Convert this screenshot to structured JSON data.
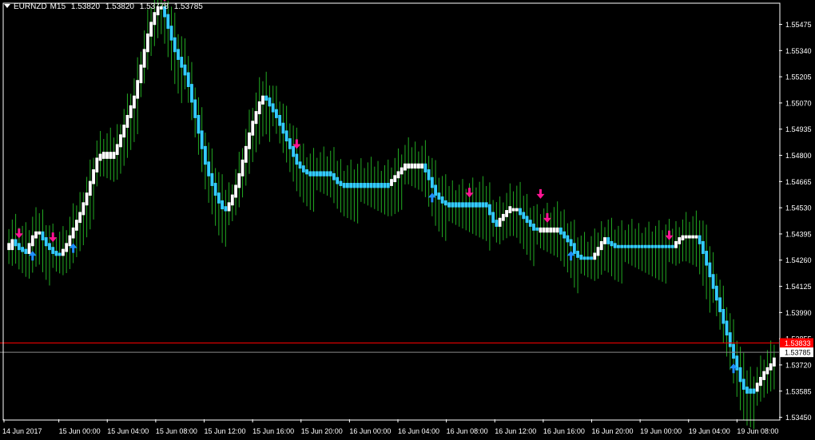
{
  "window": {
    "symbol": "EURNZD",
    "timeframe": "M15",
    "open": "1.53820",
    "high": "1.53820",
    "low": "1.53778",
    "close": "1.53785"
  },
  "price_axis": {
    "labels": [
      "1.55475",
      "1.55340",
      "1.55205",
      "1.55070",
      "1.54935",
      "1.54800",
      "1.54665",
      "1.54530",
      "1.54395",
      "1.54260",
      "1.54125",
      "1.53990",
      "1.53855",
      "1.53720",
      "1.53585",
      "1.53450"
    ]
  },
  "time_axis": {
    "labels": [
      "14 Jun 2017",
      "15 Jun 00:00",
      "15 Jun 04:00",
      "15 Jun 08:00",
      "15 Jun 12:00",
      "15 Jun 16:00",
      "15 Jun 20:00",
      "16 Jun 00:00",
      "16 Jun 04:00",
      "16 Jun 08:00",
      "16 Jun 12:00",
      "16 Jun 16:00",
      "16 Jun 20:00",
      "19 Jun 00:00",
      "19 Jun 04:00",
      "19 Jun 08:00"
    ]
  },
  "current_price": {
    "label": "1.53785",
    "value": 1.53785,
    "color": "#ffffff"
  },
  "ask_line": {
    "label": "1.53833",
    "value": 1.53833,
    "color": "#ff0000"
  },
  "colors": {
    "background": "#000000",
    "axis": "#ffffff",
    "bull_candle": "#ffffff",
    "bear_candle": "#33ccff",
    "wick": "#22aa22",
    "arrow_up": "#1e90ff",
    "arrow_down": "#ff1493"
  },
  "chart_data": {
    "type": "candlestick",
    "ylim": [
      1.5344,
      1.5558
    ],
    "y_axis_side": "right",
    "grid": false,
    "bars": [
      [
        1.5432,
        1.5436,
        1.5434,
        "w"
      ],
      [
        1.5432,
        1.5438,
        1.5436,
        "w"
      ],
      [
        1.5436,
        1.5438,
        1.5434,
        "b"
      ],
      [
        1.5434,
        1.5436,
        1.5432,
        "b"
      ],
      [
        1.5432,
        1.5434,
        1.5431,
        "b"
      ],
      [
        1.5431,
        1.5433,
        1.543,
        "b"
      ],
      [
        1.543,
        1.5434,
        1.5434,
        "w"
      ],
      [
        1.5434,
        1.5438,
        1.5438,
        "w"
      ],
      [
        1.5438,
        1.544,
        1.544,
        "w"
      ],
      [
        1.544,
        1.5442,
        1.544,
        "w"
      ],
      [
        1.544,
        1.5441,
        1.5437,
        "b"
      ],
      [
        1.5437,
        1.5438,
        1.5434,
        "b"
      ],
      [
        1.5434,
        1.5435,
        1.5432,
        "b"
      ],
      [
        1.5432,
        1.5433,
        1.543,
        "b"
      ],
      [
        1.543,
        1.5431,
        1.5429,
        "b"
      ],
      [
        1.5429,
        1.5431,
        1.5429,
        "b"
      ],
      [
        1.5429,
        1.5431,
        1.5431,
        "w"
      ],
      [
        1.5431,
        1.5434,
        1.5434,
        "w"
      ],
      [
        1.5434,
        1.5438,
        1.5438,
        "w"
      ],
      [
        1.5438,
        1.5442,
        1.5442,
        "w"
      ],
      [
        1.5442,
        1.5446,
        1.5446,
        "w"
      ],
      [
        1.5446,
        1.545,
        1.545,
        "w"
      ],
      [
        1.545,
        1.5455,
        1.5455,
        "w"
      ],
      [
        1.5455,
        1.546,
        1.546,
        "w"
      ],
      [
        1.546,
        1.5466,
        1.5466,
        "w"
      ],
      [
        1.5466,
        1.5472,
        1.5472,
        "w"
      ],
      [
        1.5472,
        1.5478,
        1.5478,
        "w"
      ],
      [
        1.5478,
        1.548,
        1.548,
        "w"
      ],
      [
        1.5479,
        1.5481,
        1.5481,
        "w"
      ],
      [
        1.5479,
        1.5481,
        1.5481,
        "w"
      ],
      [
        1.5479,
        1.5481,
        1.5481,
        "w"
      ],
      [
        1.5479,
        1.5481,
        1.5481,
        "w"
      ],
      [
        1.5481,
        1.5485,
        1.5485,
        "w"
      ],
      [
        1.5485,
        1.549,
        1.549,
        "w"
      ],
      [
        1.549,
        1.5495,
        1.5495,
        "w"
      ],
      [
        1.5495,
        1.55,
        1.55,
        "w"
      ],
      [
        1.55,
        1.5505,
        1.5505,
        "w"
      ],
      [
        1.5505,
        1.551,
        1.551,
        "w"
      ],
      [
        1.551,
        1.5518,
        1.5518,
        "w"
      ],
      [
        1.5518,
        1.5526,
        1.5526,
        "w"
      ],
      [
        1.5526,
        1.5534,
        1.5534,
        "w"
      ],
      [
        1.5534,
        1.5542,
        1.5542,
        "w"
      ],
      [
        1.5542,
        1.5548,
        1.5548,
        "w"
      ],
      [
        1.5548,
        1.5553,
        1.5553,
        "w"
      ],
      [
        1.5553,
        1.5556,
        1.5556,
        "w"
      ],
      [
        1.5556,
        1.5558,
        1.5556,
        "w"
      ],
      [
        1.5556,
        1.5557,
        1.5552,
        "b"
      ],
      [
        1.5552,
        1.5553,
        1.5546,
        "b"
      ],
      [
        1.5546,
        1.5547,
        1.554,
        "b"
      ],
      [
        1.554,
        1.5541,
        1.5534,
        "b"
      ],
      [
        1.5534,
        1.5535,
        1.553,
        "b"
      ],
      [
        1.553,
        1.5531,
        1.5526,
        "b"
      ],
      [
        1.5526,
        1.5527,
        1.5522,
        "b"
      ],
      [
        1.5522,
        1.5523,
        1.5516,
        "b"
      ],
      [
        1.5516,
        1.5517,
        1.5508,
        "b"
      ],
      [
        1.5508,
        1.5509,
        1.55,
        "b"
      ],
      [
        1.55,
        1.5501,
        1.5492,
        "b"
      ],
      [
        1.5492,
        1.5493,
        1.5484,
        "b"
      ],
      [
        1.5484,
        1.5485,
        1.5476,
        "b"
      ],
      [
        1.5476,
        1.5477,
        1.547,
        "b"
      ],
      [
        1.547,
        1.5471,
        1.5465,
        "b"
      ],
      [
        1.5465,
        1.5466,
        1.546,
        "b"
      ],
      [
        1.546,
        1.5461,
        1.5456,
        "b"
      ],
      [
        1.5456,
        1.5457,
        1.5453,
        "b"
      ],
      [
        1.5453,
        1.5454,
        1.5452,
        "b"
      ],
      [
        1.5452,
        1.5455,
        1.5455,
        "w"
      ],
      [
        1.5455,
        1.5459,
        1.5459,
        "w"
      ],
      [
        1.5459,
        1.5464,
        1.5464,
        "w"
      ],
      [
        1.5464,
        1.547,
        1.547,
        "w"
      ],
      [
        1.547,
        1.5477,
        1.5477,
        "w"
      ],
      [
        1.5477,
        1.5484,
        1.5484,
        "w"
      ],
      [
        1.5484,
        1.5491,
        1.5491,
        "w"
      ],
      [
        1.5491,
        1.5497,
        1.5497,
        "w"
      ],
      [
        1.5497,
        1.5502,
        1.5502,
        "w"
      ],
      [
        1.5502,
        1.5507,
        1.5507,
        "w"
      ],
      [
        1.5507,
        1.551,
        1.551,
        "w"
      ],
      [
        1.551,
        1.5512,
        1.5509,
        "b"
      ],
      [
        1.5509,
        1.551,
        1.5506,
        "b"
      ],
      [
        1.5506,
        1.5507,
        1.5503,
        "b"
      ],
      [
        1.5503,
        1.5504,
        1.55,
        "b"
      ],
      [
        1.55,
        1.5501,
        1.5496,
        "b"
      ],
      [
        1.5496,
        1.5497,
        1.5492,
        "b"
      ],
      [
        1.5492,
        1.5493,
        1.5488,
        "b"
      ],
      [
        1.5488,
        1.5489,
        1.5484,
        "b"
      ],
      [
        1.5484,
        1.5485,
        1.548,
        "b"
      ],
      [
        1.548,
        1.5481,
        1.5476,
        "b"
      ],
      [
        1.5476,
        1.5477,
        1.5474,
        "b"
      ],
      [
        1.5474,
        1.5475,
        1.5472,
        "b"
      ],
      [
        1.5472,
        1.5473,
        1.5471,
        "b"
      ],
      [
        1.5471,
        1.5472,
        1.547,
        "b"
      ],
      [
        1.5471,
        1.5472,
        1.547,
        "b"
      ],
      [
        1.5471,
        1.5472,
        1.547,
        "b"
      ],
      [
        1.5471,
        1.5472,
        1.547,
        "b"
      ],
      [
        1.5471,
        1.5472,
        1.547,
        "b"
      ],
      [
        1.5471,
        1.5472,
        1.547,
        "b"
      ],
      [
        1.5471,
        1.5472,
        1.547,
        "b"
      ],
      [
        1.547,
        1.5471,
        1.5468,
        "b"
      ],
      [
        1.5468,
        1.5469,
        1.5466,
        "b"
      ],
      [
        1.5466,
        1.5467,
        1.5465,
        "b"
      ],
      [
        1.5465,
        1.5466,
        1.5464,
        "b"
      ],
      [
        1.5465,
        1.5466,
        1.5464,
        "b"
      ],
      [
        1.5465,
        1.5466,
        1.5464,
        "b"
      ],
      [
        1.5465,
        1.5466,
        1.5464,
        "b"
      ],
      [
        1.5465,
        1.5466,
        1.5464,
        "b"
      ],
      [
        1.5465,
        1.5466,
        1.5464,
        "b"
      ],
      [
        1.5465,
        1.5466,
        1.5464,
        "b"
      ],
      [
        1.5465,
        1.5466,
        1.5464,
        "b"
      ],
      [
        1.5465,
        1.5466,
        1.5464,
        "b"
      ],
      [
        1.5465,
        1.5466,
        1.5464,
        "b"
      ],
      [
        1.5465,
        1.5466,
        1.5464,
        "b"
      ],
      [
        1.5465,
        1.5466,
        1.5464,
        "b"
      ],
      [
        1.5465,
        1.5466,
        1.5464,
        "b"
      ],
      [
        1.5465,
        1.5466,
        1.5464,
        "b"
      ],
      [
        1.5465,
        1.5467,
        1.5467,
        "w"
      ],
      [
        1.5467,
        1.5469,
        1.5469,
        "w"
      ],
      [
        1.5469,
        1.5471,
        1.5471,
        "w"
      ],
      [
        1.5471,
        1.5473,
        1.5473,
        "w"
      ],
      [
        1.5473,
        1.5475,
        1.5475,
        "w"
      ],
      [
        1.5474,
        1.5476,
        1.5475,
        "w"
      ],
      [
        1.5474,
        1.5476,
        1.5475,
        "w"
      ],
      [
        1.5474,
        1.5476,
        1.5475,
        "w"
      ],
      [
        1.5474,
        1.5476,
        1.5475,
        "w"
      ],
      [
        1.5474,
        1.5476,
        1.5475,
        "w"
      ],
      [
        1.5475,
        1.5476,
        1.5472,
        "b"
      ],
      [
        1.5472,
        1.5473,
        1.5468,
        "b"
      ],
      [
        1.5468,
        1.5469,
        1.5464,
        "b"
      ],
      [
        1.5464,
        1.5465,
        1.546,
        "b"
      ],
      [
        1.546,
        1.5461,
        1.5458,
        "b"
      ],
      [
        1.5458,
        1.5459,
        1.5456,
        "b"
      ],
      [
        1.5456,
        1.5457,
        1.5455,
        "b"
      ],
      [
        1.5455,
        1.5456,
        1.5454,
        "b"
      ],
      [
        1.5455,
        1.5456,
        1.5454,
        "b"
      ],
      [
        1.5455,
        1.5456,
        1.5454,
        "b"
      ],
      [
        1.5455,
        1.5456,
        1.5454,
        "b"
      ],
      [
        1.5455,
        1.5456,
        1.5454,
        "b"
      ],
      [
        1.5455,
        1.5456,
        1.5454,
        "b"
      ],
      [
        1.5455,
        1.5456,
        1.5454,
        "b"
      ],
      [
        1.5455,
        1.5456,
        1.5454,
        "b"
      ],
      [
        1.5455,
        1.5456,
        1.5454,
        "b"
      ],
      [
        1.5455,
        1.5456,
        1.5454,
        "b"
      ],
      [
        1.5455,
        1.5456,
        1.5454,
        "b"
      ],
      [
        1.5455,
        1.5456,
        1.5454,
        "b"
      ],
      [
        1.5454,
        1.5455,
        1.545,
        "b"
      ],
      [
        1.545,
        1.5451,
        1.5446,
        "b"
      ],
      [
        1.5446,
        1.5447,
        1.5444,
        "b"
      ],
      [
        1.5444,
        1.5447,
        1.5447,
        "w"
      ],
      [
        1.5447,
        1.5449,
        1.5449,
        "w"
      ],
      [
        1.5449,
        1.5451,
        1.5451,
        "w"
      ],
      [
        1.5451,
        1.5453,
        1.5453,
        "w"
      ],
      [
        1.5452,
        1.5454,
        1.5452,
        "w"
      ],
      [
        1.5452,
        1.5454,
        1.5452,
        "w"
      ],
      [
        1.5452,
        1.5453,
        1.545,
        "b"
      ],
      [
        1.545,
        1.5451,
        1.5448,
        "b"
      ],
      [
        1.5448,
        1.5449,
        1.5446,
        "b"
      ],
      [
        1.5446,
        1.5447,
        1.5444,
        "b"
      ],
      [
        1.5444,
        1.5445,
        1.5442,
        "b"
      ],
      [
        1.5442,
        1.5443,
        1.5442,
        "b"
      ],
      [
        1.5441,
        1.5443,
        1.5442,
        "w"
      ],
      [
        1.5441,
        1.5443,
        1.5442,
        "w"
      ],
      [
        1.5441,
        1.5443,
        1.5442,
        "w"
      ],
      [
        1.5441,
        1.5443,
        1.5442,
        "w"
      ],
      [
        1.5441,
        1.5443,
        1.5442,
        "w"
      ],
      [
        1.5441,
        1.5443,
        1.5442,
        "w"
      ],
      [
        1.5442,
        1.5443,
        1.544,
        "b"
      ],
      [
        1.544,
        1.5441,
        1.5438,
        "b"
      ],
      [
        1.5438,
        1.5439,
        1.5436,
        "b"
      ],
      [
        1.5436,
        1.5437,
        1.5434,
        "b"
      ],
      [
        1.5434,
        1.5435,
        1.543,
        "b"
      ],
      [
        1.543,
        1.5431,
        1.5428,
        "b"
      ],
      [
        1.5428,
        1.5429,
        1.5427,
        "b"
      ],
      [
        1.5427,
        1.5428,
        1.5427,
        "b"
      ],
      [
        1.5427,
        1.5428,
        1.5427,
        "b"
      ],
      [
        1.5427,
        1.5428,
        1.5427,
        "b"
      ],
      [
        1.5427,
        1.5429,
        1.5429,
        "w"
      ],
      [
        1.5429,
        1.5432,
        1.5432,
        "w"
      ],
      [
        1.5432,
        1.5435,
        1.5435,
        "w"
      ],
      [
        1.5435,
        1.5437,
        1.5437,
        "w"
      ],
      [
        1.5437,
        1.5438,
        1.5435,
        "b"
      ],
      [
        1.5435,
        1.5436,
        1.5434,
        "b"
      ],
      [
        1.5434,
        1.5435,
        1.5433,
        "b"
      ],
      [
        1.5433,
        1.5434,
        1.5433,
        "b"
      ],
      [
        1.5433,
        1.5434,
        1.5433,
        "b"
      ],
      [
        1.5433,
        1.5434,
        1.5433,
        "b"
      ],
      [
        1.5433,
        1.5434,
        1.5433,
        "b"
      ],
      [
        1.5433,
        1.5434,
        1.5433,
        "b"
      ],
      [
        1.5433,
        1.5434,
        1.5433,
        "b"
      ],
      [
        1.5433,
        1.5434,
        1.5433,
        "b"
      ],
      [
        1.5433,
        1.5434,
        1.5433,
        "b"
      ],
      [
        1.5433,
        1.5434,
        1.5433,
        "b"
      ],
      [
        1.5433,
        1.5434,
        1.5433,
        "b"
      ],
      [
        1.5433,
        1.5434,
        1.5433,
        "b"
      ],
      [
        1.5433,
        1.5434,
        1.5433,
        "b"
      ],
      [
        1.5433,
        1.5434,
        1.5433,
        "b"
      ],
      [
        1.5433,
        1.5434,
        1.5433,
        "b"
      ],
      [
        1.5433,
        1.5434,
        1.5433,
        "b"
      ],
      [
        1.5433,
        1.5434,
        1.5433,
        "b"
      ],
      [
        1.5433,
        1.5434,
        1.5433,
        "b"
      ],
      [
        1.5433,
        1.5435,
        1.5435,
        "w"
      ],
      [
        1.5435,
        1.5437,
        1.5437,
        "w"
      ],
      [
        1.5437,
        1.5438,
        1.5438,
        "w"
      ],
      [
        1.5438,
        1.5439,
        1.5438,
        "w"
      ],
      [
        1.5438,
        1.5439,
        1.5438,
        "w"
      ],
      [
        1.5438,
        1.5439,
        1.5438,
        "w"
      ],
      [
        1.5438,
        1.5439,
        1.5438,
        "w"
      ],
      [
        1.5438,
        1.5439,
        1.5435,
        "b"
      ],
      [
        1.5435,
        1.5436,
        1.543,
        "b"
      ],
      [
        1.543,
        1.5431,
        1.5424,
        "b"
      ],
      [
        1.5424,
        1.5425,
        1.5418,
        "b"
      ],
      [
        1.5418,
        1.5419,
        1.5412,
        "b"
      ],
      [
        1.5412,
        1.5413,
        1.5406,
        "b"
      ],
      [
        1.5406,
        1.5407,
        1.54,
        "b"
      ],
      [
        1.54,
        1.5401,
        1.5394,
        "b"
      ],
      [
        1.5394,
        1.5395,
        1.5388,
        "b"
      ],
      [
        1.5388,
        1.5389,
        1.5382,
        "b"
      ],
      [
        1.5382,
        1.5383,
        1.5376,
        "b"
      ],
      [
        1.5376,
        1.5377,
        1.537,
        "b"
      ],
      [
        1.537,
        1.5371,
        1.5364,
        "b"
      ],
      [
        1.5364,
        1.5365,
        1.536,
        "b"
      ],
      [
        1.536,
        1.5361,
        1.5358,
        "b"
      ],
      [
        1.5358,
        1.536,
        1.5359,
        "b"
      ],
      [
        1.5358,
        1.536,
        1.5359,
        "b"
      ],
      [
        1.5359,
        1.5362,
        1.5362,
        "w"
      ],
      [
        1.5362,
        1.5365,
        1.5365,
        "w"
      ],
      [
        1.5365,
        1.5368,
        1.5368,
        "w"
      ],
      [
        1.5368,
        1.537,
        1.537,
        "w"
      ],
      [
        1.537,
        1.5372,
        1.5372,
        "w"
      ],
      [
        1.5372,
        1.5375,
        1.5375,
        "w"
      ]
    ],
    "signals_up": [
      7,
      19,
      125,
      166,
      214,
      234
    ],
    "signals_down": [
      3,
      13,
      46,
      85,
      136,
      159,
      195,
      239
    ],
    "signals_down_high": [
      157
    ]
  }
}
